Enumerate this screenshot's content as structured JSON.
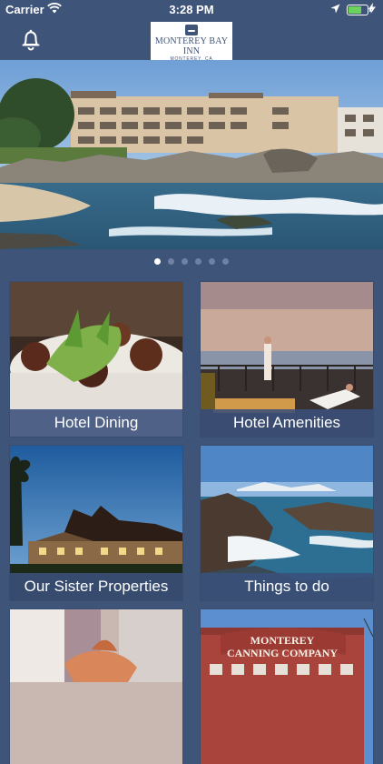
{
  "status_bar": {
    "carrier": "Carrier",
    "time": "3:28 PM",
    "wifi_icon": "wifi-icon",
    "location_icon": "location-arrow-icon",
    "battery_level": 0.75,
    "battery_color": "#6bd35b"
  },
  "nav": {
    "notifications_icon": "bell-icon",
    "logo": {
      "name": "MONTEREY BAY INN",
      "city": "MONTEREY, CA"
    }
  },
  "carousel": {
    "slide_count": 6,
    "active_index": 0
  },
  "menu": [
    {
      "label": "Hotel Dining"
    },
    {
      "label": "Hotel Amenities"
    },
    {
      "label": "Our Sister Properties"
    },
    {
      "label": "Things to do"
    },
    {
      "label": ""
    },
    {
      "label": ""
    }
  ],
  "colors": {
    "brand_navy": "#3f5479",
    "caption_bar": "#3a507a",
    "dot_active": "#ffffff",
    "dot_inactive": "#6f82a3"
  }
}
